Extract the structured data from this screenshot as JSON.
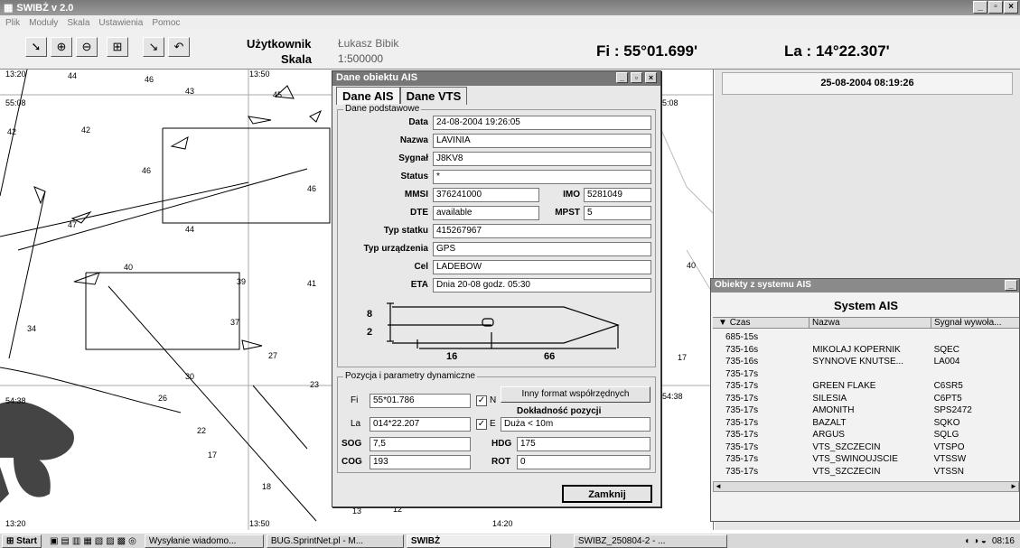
{
  "app": {
    "title": "SWIBŻ v 2.0"
  },
  "menu": [
    "Plik",
    "Moduły",
    "Skala",
    "Ustawienia",
    "Pomoc"
  ],
  "toolbar": {
    "user_label": "Użytkownik",
    "user_value": "Łukasz Bibik",
    "scale_label": "Skala",
    "scale_value": "1:500000",
    "fi_label": "Fi :",
    "fi_value": "55°01.699'",
    "la_label": "La :",
    "la_value": "14°22.307'"
  },
  "map": {
    "numbers": [
      "44",
      "46",
      "43",
      "45",
      "42",
      "46",
      "47",
      "44",
      "41",
      "40",
      "39",
      "37",
      "34",
      "30",
      "27",
      "26",
      "22",
      "23",
      "17",
      "18",
      "13",
      "12",
      "40"
    ],
    "times": [
      "13:20",
      "13:50",
      "55:08",
      "13:50",
      "54:38",
      "13:20",
      "14:20",
      "5:08",
      "54:38"
    ]
  },
  "clock": "25-08-2004 08:19:26",
  "dialog": {
    "title": "Dane obiektu AIS",
    "tabs": [
      "Dane AIS",
      "Dane VTS"
    ],
    "group1": "Dane podstawowe",
    "labels": {
      "data": "Data",
      "nazwa": "Nazwa",
      "sygnal": "Sygnał",
      "status": "Status",
      "mmsi": "MMSI",
      "imo": "IMO",
      "dte": "DTE",
      "mpst": "MPST",
      "typ_statku": "Typ statku",
      "typ_urzadzenia": "Typ urządzenia",
      "cel": "Cel",
      "eta": "ETA"
    },
    "values": {
      "data": "24-08-2004 19:26:05",
      "nazwa": "LAVINIA",
      "sygnal": "J8KV8",
      "status": "*",
      "mmsi": "376241000",
      "imo": "5281049",
      "dte": "available",
      "mpst": "5",
      "typ_statku": "415267967",
      "typ_urzadzenia": "GPS",
      "cel": "LADEBOW",
      "eta": "Dnia 20-08 godz. 05:30"
    },
    "dims": {
      "a": "8",
      "b": "2",
      "c": "16",
      "d": "66"
    },
    "group2": "Pozycja i parametry dynamiczne",
    "pos": {
      "fi_label": "Fi",
      "fi_value": "55*01.786",
      "n_label": "N",
      "la_label": "La",
      "la_value": "014*22.207",
      "e_label": "E",
      "format_button": "Inny format współrzędnych",
      "accuracy_label": "Dokładność pozycji",
      "accuracy_value": "Duża < 10m",
      "sog_label": "SOG",
      "sog_value": "7,5",
      "hdg_label": "HDG",
      "hdg_value": "175",
      "cog_label": "COG",
      "cog_value": "193",
      "rot_label": "ROT",
      "rot_value": "0"
    },
    "close_button": "Zamknij"
  },
  "ais_window": {
    "title": "Obiekty z systemu AIS",
    "heading": "System AIS",
    "columns": [
      "Czas",
      "Nazwa",
      "Sygnał wywoła..."
    ],
    "rows": [
      [
        "685-15s",
        "",
        ""
      ],
      [
        "735-16s",
        "MIKOLAJ KOPERNIK",
        "SQEC"
      ],
      [
        "735-16s",
        "SYNNOVE KNUTSE...",
        "LA004"
      ],
      [
        "735-17s",
        "",
        ""
      ],
      [
        "735-17s",
        "GREEN FLAKE",
        "C6SR5"
      ],
      [
        "735-17s",
        "SILESIA",
        "C6PT5"
      ],
      [
        "735-17s",
        "AMONITH",
        "SPS2472"
      ],
      [
        "735-17s",
        "BAZALT",
        "SQKO"
      ],
      [
        "735-17s",
        "ARGUS",
        "SQLG"
      ],
      [
        "735-17s",
        "VTS_SZCZECIN",
        "VTSPO"
      ],
      [
        "735-17s",
        "VTS_SWINOUJSCIE",
        "VTSSW"
      ],
      [
        "735-17s",
        "VTS_SZCZECIN",
        "VTSSN"
      ]
    ]
  },
  "taskbar": {
    "start": "Start",
    "tasks": [
      "Wysyłanie wiadomo...",
      "BUG.SprintNet.pl - M...",
      "SWIBŻ",
      "SWIBZ_250804-2 - ..."
    ],
    "clock": "08:16"
  }
}
